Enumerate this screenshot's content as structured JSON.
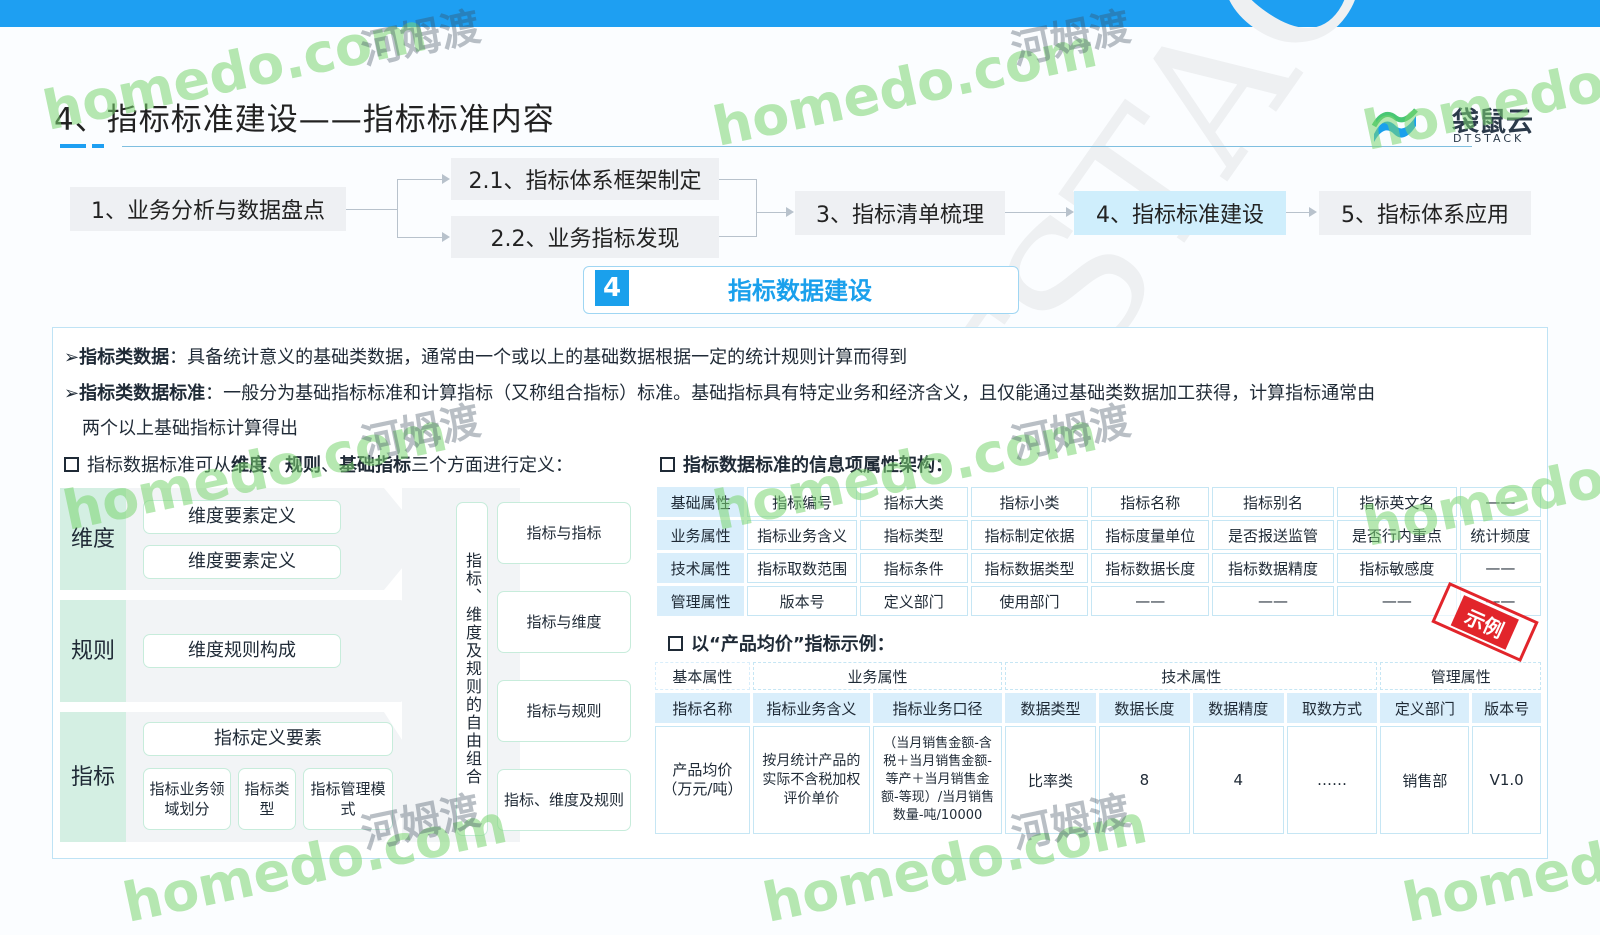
{
  "slide": {
    "title": "4、指标标准建设——指标标准内容"
  },
  "logo": {
    "name": "袋鼠云",
    "sub": "DTSTACK"
  },
  "flow": {
    "steps": [
      "1、业务分析与数据盘点",
      "2.1、指标体系框架制定",
      "2.2、业务指标发现",
      "3、指标清单梳理",
      "4、指标标准建设",
      "5、指标体系应用"
    ],
    "active_index": 4
  },
  "section": {
    "number": "4",
    "title": "指标数据建设"
  },
  "definitions": {
    "line1_term": "指标类数据",
    "line1_text": "：具备统计意义的基础类数据，通常由一个或以上的基础数据根据一定的统计规则计算而得到",
    "line2_term": "指标类数据标准",
    "line2_text": "：一般分为基础指标标准和计算指标（又称组合指标）标准。基础指标具有特定业务和经济含义，且仅能通过基础类数据加工获得，计算指标通常由",
    "line3_text": "两个以上基础指标计算得出"
  },
  "left_section": {
    "heading_pre": "指标数据标准可从",
    "heading_b1": "维度",
    "heading_sep1": "、",
    "heading_b2": "规则",
    "heading_sep2": "、",
    "heading_b3": "基础指标",
    "heading_post": "三个方面进行定义：",
    "dimension_label": "维度",
    "dimension_items": [
      "维度要素定义",
      "维度要素定义"
    ],
    "rule_label": "规则",
    "rule_items": [
      "维度规则构成"
    ],
    "indicator_label": "指标",
    "indicator_def": "指标定义要素",
    "indicator_sub": [
      "指标业务领域划分",
      "指标类型",
      "指标管理模式"
    ],
    "combination": "指标、维度及规则的自由组合",
    "relations": [
      "指标与指标",
      "指标与维度",
      "指标与规则",
      "指标、维度及规则"
    ]
  },
  "right_section": {
    "heading": "指标数据标准的信息项属性架构：",
    "attr_table": [
      [
        "基础属性",
        "指标编号",
        "指标大类",
        "指标小类",
        "指标名称",
        "指标别名",
        "指标英文名",
        "——"
      ],
      [
        "业务属性",
        "指标业务含义",
        "指标类型",
        "指标制定依据",
        "指标度量单位",
        "是否报送监管",
        "是否行内重点",
        "统计频度"
      ],
      [
        "技术属性",
        "指标取数范围",
        "指标条件",
        "指标数据类型",
        "指标数据长度",
        "指标数据精度",
        "指标敏感度",
        "——"
      ],
      [
        "管理属性",
        "版本号",
        "定义部门",
        "使用部门",
        "——",
        "——",
        "——",
        "——"
      ]
    ],
    "example_heading": "以“产品均价”指标示例：",
    "stamp": "示例",
    "example_groups": [
      "基本属性",
      "业务属性",
      "技术属性",
      "管理属性"
    ],
    "example_headers": [
      "指标名称",
      "指标业务含义",
      "指标业务口径",
      "数据类型",
      "数据长度",
      "数据精度",
      "取数方式",
      "定义部门",
      "版本号"
    ],
    "example_row": [
      "产品均价（万元/吨）",
      "按月统计产品的实际不含税加权评价单价",
      "（当月销售金额-含税＋当月销售金额-等产＋当月销售金额-等现）/当月销售数量-吨/10000",
      "比率类",
      "8",
      "4",
      "……",
      "销售部",
      "V1.0"
    ]
  },
  "watermarks": {
    "latin": "homedo.com",
    "cn": "河姆渡",
    "diag": "DTSTACK"
  },
  "colors": {
    "topbar": "#1e9ff2",
    "accent": "#1aa0ec",
    "active_step": "#cfeefc",
    "green_label": "#d4efe3",
    "table_header": "#d9eefb",
    "stamp": "#e2252b"
  }
}
